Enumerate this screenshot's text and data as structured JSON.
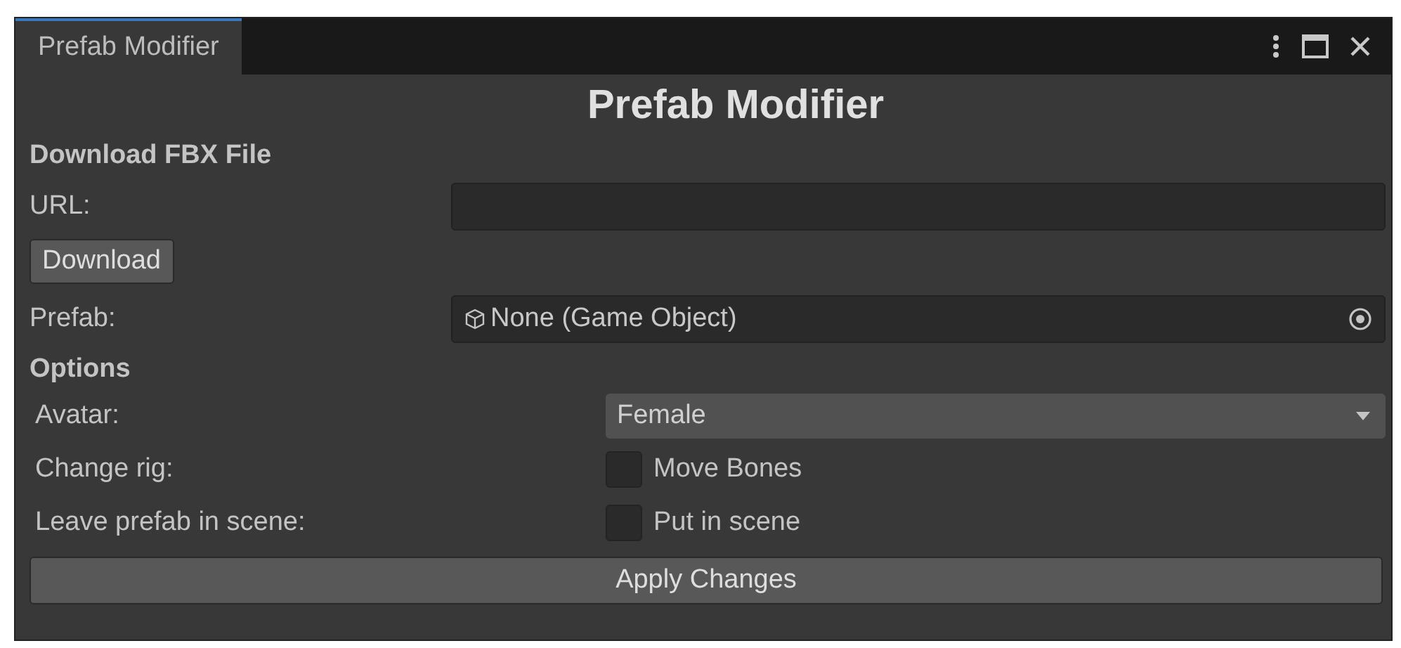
{
  "window": {
    "tab": {
      "label": "Prefab Modifier",
      "selected": true
    }
  },
  "title": "Prefab Modifier",
  "download_section": {
    "heading": "Download FBX File",
    "url_label": "URL:",
    "download_button": "Download"
  },
  "prefab": {
    "label": "Prefab:",
    "value": "None (Game Object)"
  },
  "options": {
    "heading": "Options",
    "rows": [
      {
        "kind": "dropdown",
        "label": "Avatar:",
        "value": "Female"
      },
      {
        "kind": "checkbox",
        "label": "Change rig:",
        "text": "Move Bones",
        "checked": false
      },
      {
        "kind": "checkbox",
        "label": "Leave prefab in scene:",
        "text": "Put in scene",
        "checked": false
      }
    ]
  },
  "apply_button": "Apply Changes"
}
